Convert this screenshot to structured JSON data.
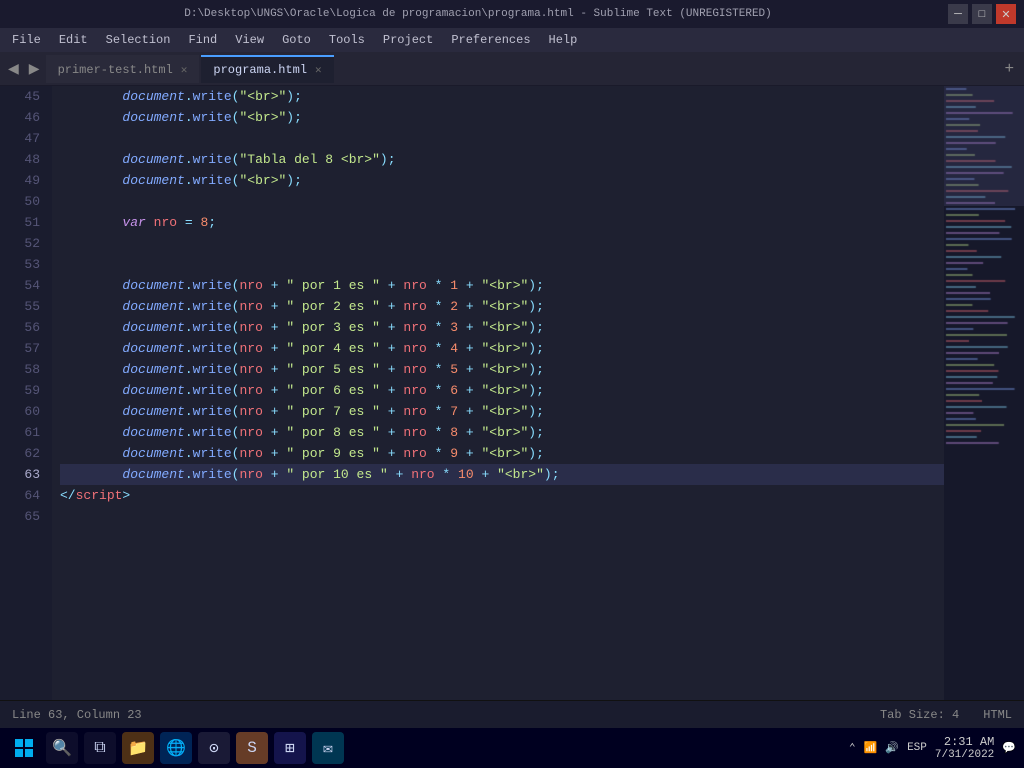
{
  "window": {
    "title": "D:\\Desktop\\UNGS\\Oracle\\Logica de programacion\\programa.html - Sublime Text (UNREGISTERED)",
    "controls": {
      "minimize": "─",
      "restore": "□",
      "close": "✕"
    }
  },
  "menu": {
    "items": [
      "File",
      "Edit",
      "Selection",
      "Find",
      "View",
      "Goto",
      "Tools",
      "Project",
      "Preferences",
      "Help"
    ]
  },
  "tabs": {
    "prev_btn": "◀",
    "next_btn": "▶",
    "items": [
      {
        "label": "primer-test.html",
        "active": false
      },
      {
        "label": "programa.html",
        "active": true
      }
    ],
    "add_btn": "+"
  },
  "editor": {
    "lines": [
      {
        "num": "45",
        "content": ""
      },
      {
        "num": "46",
        "content": ""
      },
      {
        "num": "47",
        "content": ""
      },
      {
        "num": "48",
        "content": ""
      },
      {
        "num": "49",
        "content": ""
      },
      {
        "num": "50",
        "content": ""
      },
      {
        "num": "51",
        "content": ""
      },
      {
        "num": "52",
        "content": ""
      },
      {
        "num": "53",
        "content": ""
      },
      {
        "num": "54",
        "content": ""
      },
      {
        "num": "55",
        "content": ""
      },
      {
        "num": "56",
        "content": ""
      },
      {
        "num": "57",
        "content": ""
      },
      {
        "num": "58",
        "content": ""
      },
      {
        "num": "59",
        "content": ""
      },
      {
        "num": "60",
        "content": ""
      },
      {
        "num": "61",
        "content": ""
      },
      {
        "num": "62",
        "content": ""
      },
      {
        "num": "63",
        "content": "",
        "highlight": true
      },
      {
        "num": "64",
        "content": ""
      },
      {
        "num": "65",
        "content": ""
      }
    ]
  },
  "status": {
    "left": "Line 63, Column 23",
    "tab_size": "Tab Size: 4",
    "language": "HTML"
  },
  "taskbar": {
    "time": "2:31 AM",
    "date": "7/31/2022",
    "language": "ESP",
    "start_icon": "⊞",
    "search_icon": "🔍",
    "taskview_icon": "⧉"
  }
}
